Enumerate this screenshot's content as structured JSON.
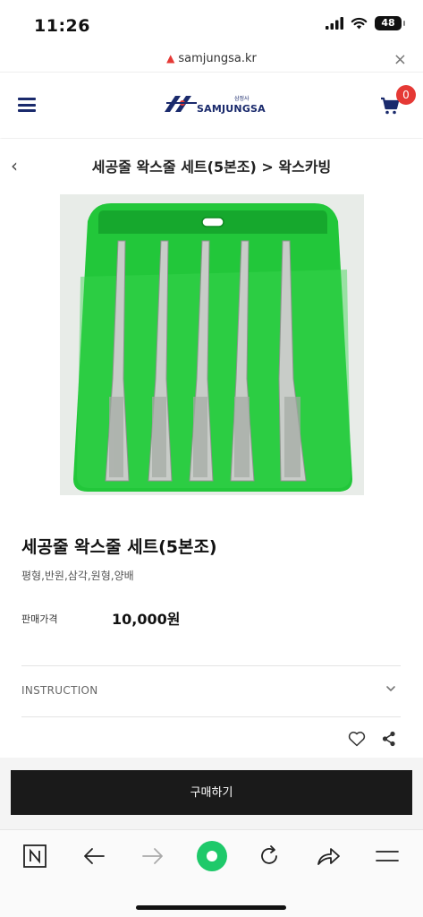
{
  "status": {
    "time": "11:26",
    "battery": "48"
  },
  "browser": {
    "url": "samjungsa.kr",
    "close": "×"
  },
  "header": {
    "logo_text": "SAMJUNGSA",
    "logo_small": "삼정사",
    "cart_count": "0"
  },
  "titlebar": {
    "title": "세공줄 왁스줄 세트(5본조) > 왁스카빙"
  },
  "product": {
    "name": "세공줄 왁스줄 세트(5본조)",
    "subtitle": "평형,반원,삼각,원형,양배",
    "price_label": "판매가격",
    "price": "10,000원",
    "instruction_label": "INSTRUCTION"
  },
  "buy": {
    "label": "구매하기"
  },
  "colors": {
    "accent": "#1a2a6c",
    "badge": "#e53935",
    "buy_bg": "#1a1a1a",
    "pouch_green": "#22c73a",
    "nav_green": "#1ec96a"
  }
}
